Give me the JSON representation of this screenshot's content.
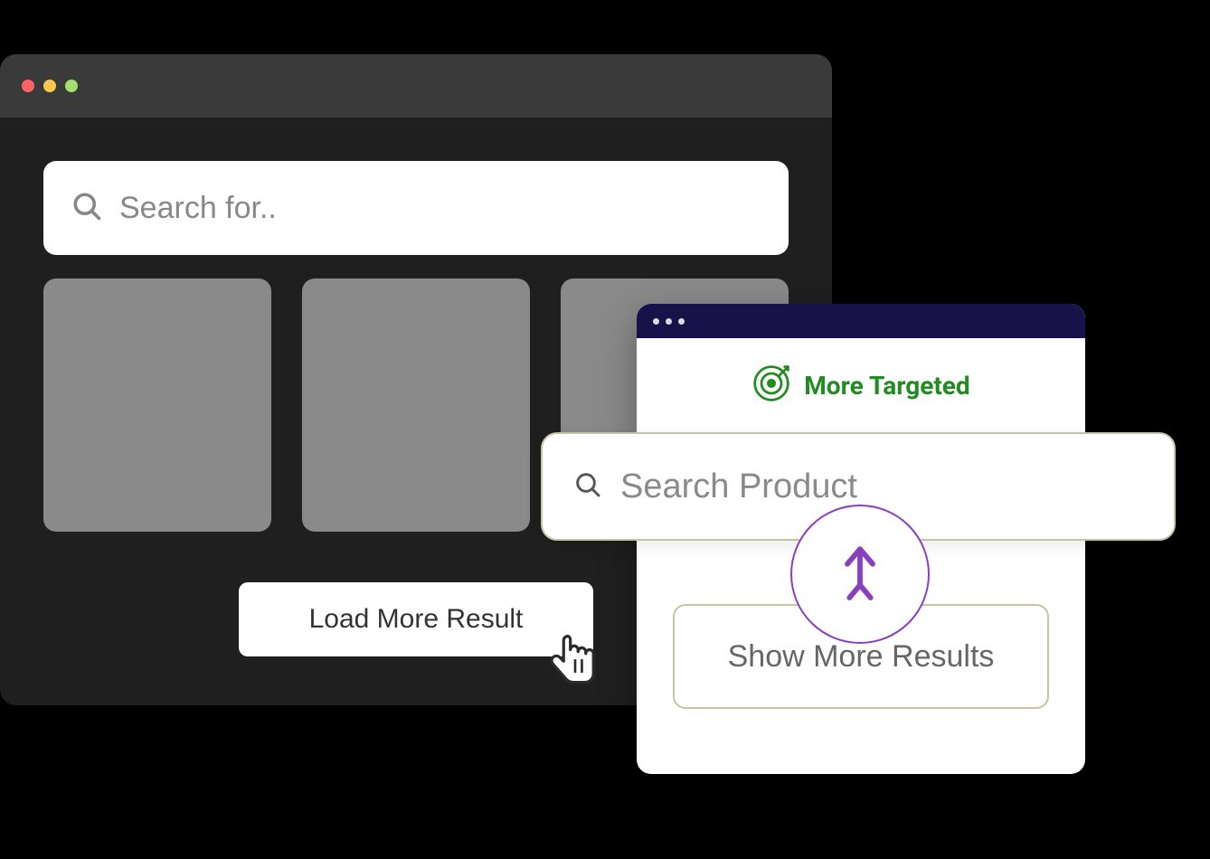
{
  "dark_window": {
    "search_placeholder": "Search for..",
    "load_more_label": "Load More Result"
  },
  "light_window": {
    "badge_text": "More Targeted",
    "product_search_placeholder": "Search Product",
    "show_more_label": "Show More Results"
  },
  "colors": {
    "accent_green": "#228b22",
    "accent_purple": "#8a3fbf",
    "navy": "#17124a"
  }
}
